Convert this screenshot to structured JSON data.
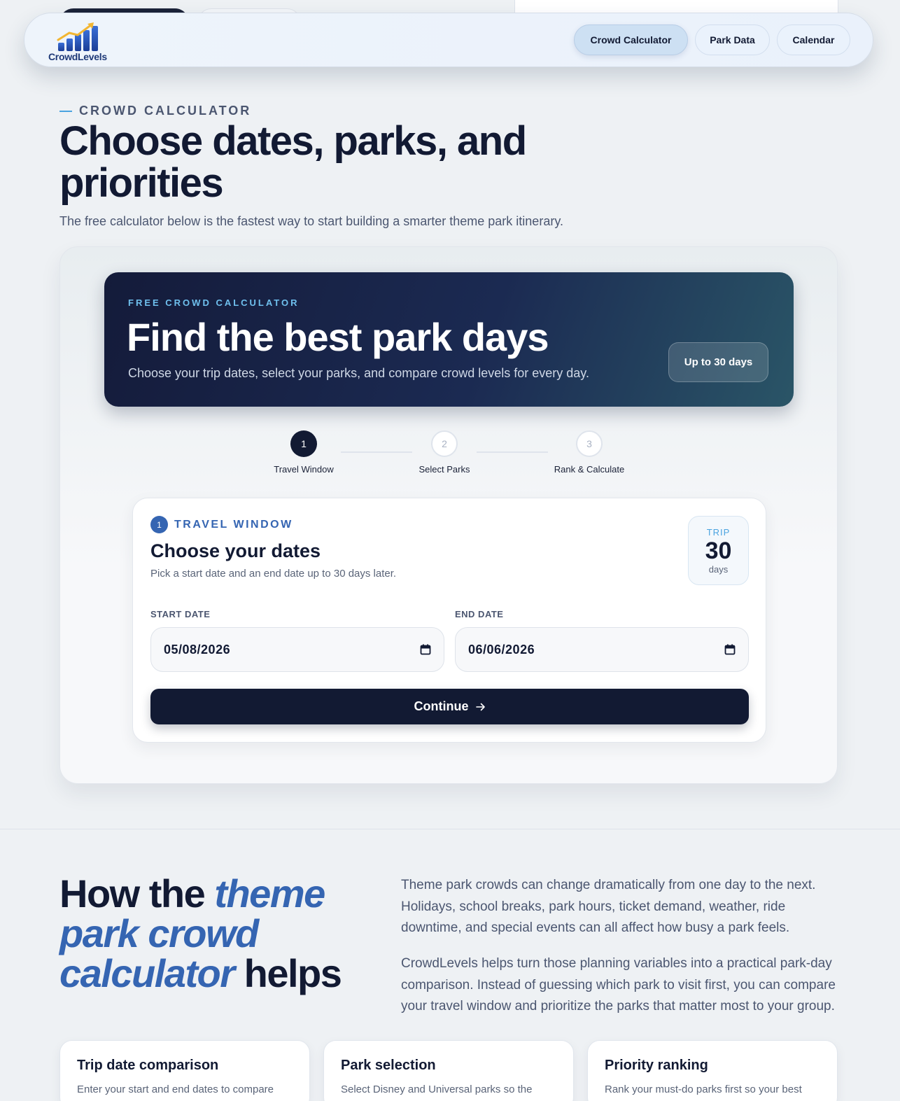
{
  "nav": {
    "logo_text": "CrowdLevels",
    "items": [
      "Crowd Calculator",
      "Park Data",
      "Calendar"
    ]
  },
  "hero": {
    "eyebrow": "CROWD CALCULATOR",
    "title": "Choose dates, parks, and priorities",
    "lede": "The free calculator below is the fastest way to start building a smarter theme park itinerary."
  },
  "banner": {
    "eyebrow": "FREE CROWD CALCULATOR",
    "title": "Find the best park days",
    "subtitle": "Choose your trip dates, select your parks, and compare crowd levels for every day.",
    "badge": "Up to 30 days"
  },
  "stepper": [
    {
      "num": "1",
      "label": "Travel Window",
      "active": true
    },
    {
      "num": "2",
      "label": "Select Parks",
      "active": false
    },
    {
      "num": "3",
      "label": "Rank & Calculate",
      "active": false
    }
  ],
  "form": {
    "section_num": "1",
    "section_label": "TRAVEL WINDOW",
    "title": "Choose your dates",
    "subtitle": "Pick a start date and an end date up to 30 days later.",
    "trip_label": "TRIP",
    "trip_days": "30",
    "trip_unit": "days",
    "start_label": "START DATE",
    "start_value": "05/08/2026",
    "end_label": "END DATE",
    "end_value": "06/06/2026",
    "continue_label": "Continue"
  },
  "how": {
    "title_pre": "How the",
    "title_accent": "theme park crowd calculator",
    "title_post": "helps",
    "para1": "Theme park crowds can change dramatically from one day to the next. Holidays, school breaks, park hours, ticket demand, weather, ride downtime, and special events can all affect how busy a park feels.",
    "para2": "CrowdLevels helps turn those planning variables into a practical park-day comparison. Instead of guessing which park to visit first, you can compare your travel window and prioritize the parks that matter most to your group."
  },
  "features": [
    {
      "title": "Trip date comparison",
      "desc": "Enter your start and end dates to compare"
    },
    {
      "title": "Park selection",
      "desc": "Select Disney and Universal parks so the"
    },
    {
      "title": "Priority ranking",
      "desc": "Rank your must-do parks first so your best"
    }
  ],
  "colors": {
    "navy": "#121a33",
    "accent_blue": "#3565b2",
    "sky": "#4aa3e0"
  }
}
